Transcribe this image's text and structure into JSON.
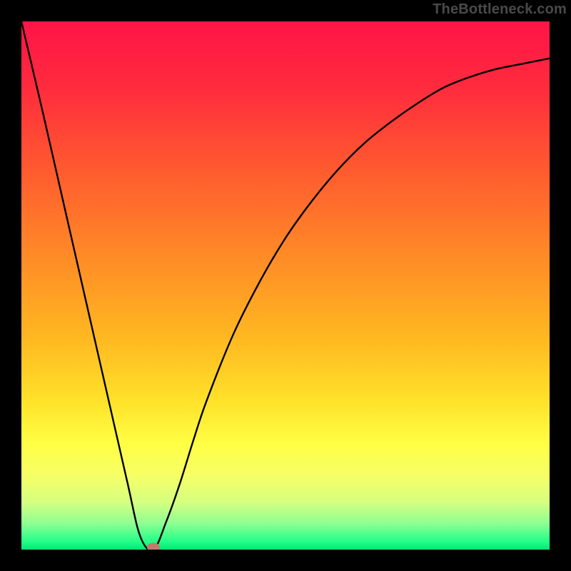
{
  "attribution": "TheBottleneck.com",
  "colors": {
    "background": "#000000",
    "attribution_text": "#4a4a4a",
    "curve": "#000000",
    "marker_fill": "#c47a6a",
    "gradient_stops": [
      {
        "offset": 0.0,
        "color": "#ff1447"
      },
      {
        "offset": 0.12,
        "color": "#ff2a3e"
      },
      {
        "offset": 0.28,
        "color": "#ff5a2f"
      },
      {
        "offset": 0.45,
        "color": "#ff8c26"
      },
      {
        "offset": 0.6,
        "color": "#ffb821"
      },
      {
        "offset": 0.72,
        "color": "#ffe22a"
      },
      {
        "offset": 0.8,
        "color": "#ffff44"
      },
      {
        "offset": 0.86,
        "color": "#f6ff66"
      },
      {
        "offset": 0.91,
        "color": "#d6ff80"
      },
      {
        "offset": 0.95,
        "color": "#8fff92"
      },
      {
        "offset": 0.985,
        "color": "#22ff88"
      },
      {
        "offset": 1.0,
        "color": "#00e874"
      }
    ]
  },
  "chart_data": {
    "type": "line",
    "title": "",
    "xlabel": "",
    "ylabel": "",
    "xlim": [
      0,
      10
    ],
    "ylim": [
      0,
      10
    ],
    "grid": false,
    "series": [
      {
        "name": "bottleneck-curve",
        "x": [
          0.0,
          0.4,
          0.8,
          1.2,
          1.6,
          2.0,
          2.25,
          2.5,
          2.75,
          3.0,
          3.25,
          3.5,
          4.0,
          4.5,
          5.0,
          5.5,
          6.0,
          6.5,
          7.0,
          7.5,
          8.0,
          8.5,
          9.0,
          9.5,
          10.0
        ],
        "y": [
          10.0,
          8.3,
          6.55,
          4.8,
          3.05,
          1.3,
          0.25,
          0.0,
          0.55,
          1.25,
          2.05,
          2.8,
          4.05,
          5.05,
          5.9,
          6.6,
          7.2,
          7.7,
          8.1,
          8.45,
          8.75,
          8.95,
          9.1,
          9.2,
          9.3
        ]
      }
    ],
    "marker": {
      "x": 2.5,
      "y": 0.0,
      "rx": 0.12,
      "ry": 0.09
    }
  }
}
